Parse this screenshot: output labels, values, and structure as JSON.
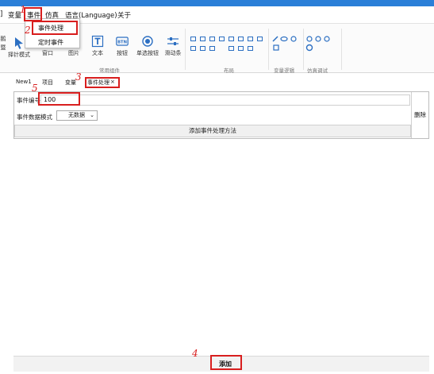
{
  "menubar": {
    "items": [
      "]",
      "变量",
      "事件",
      "仿真",
      "语言(Language)",
      "关于"
    ]
  },
  "dropdown": {
    "items": [
      "事件处理",
      "定时事件"
    ]
  },
  "ribbon": {
    "left_partial": [
      "鹅",
      "暨",
      "择针模式"
    ],
    "buttons": [
      "窗口",
      "图片",
      "文本",
      "按钮",
      "单选按钮",
      "滑动条"
    ],
    "btn_icon_text": "BTN",
    "groups": [
      "常用组件",
      "布局",
      "变量逻辑",
      "仿真调试"
    ]
  },
  "tabs": {
    "items": [
      "New1",
      "项目",
      "变量",
      "事件处理"
    ],
    "close_glyph": "×"
  },
  "form": {
    "event_id_label": "事件编号",
    "event_id_value": "100",
    "event_data_mode_label": "事件数据模式",
    "event_data_mode_value": "无数据",
    "add_method_label": "添加事件处理方法",
    "delete_label": "删除"
  },
  "bottom": {
    "add_label": "添加"
  },
  "annotations": [
    "1",
    "2",
    "3",
    "4",
    "5"
  ],
  "colors": {
    "title_bar": "#2b7fd8",
    "annotation_red": "#d81e1e",
    "icon_blue": "#2c6fc2"
  }
}
